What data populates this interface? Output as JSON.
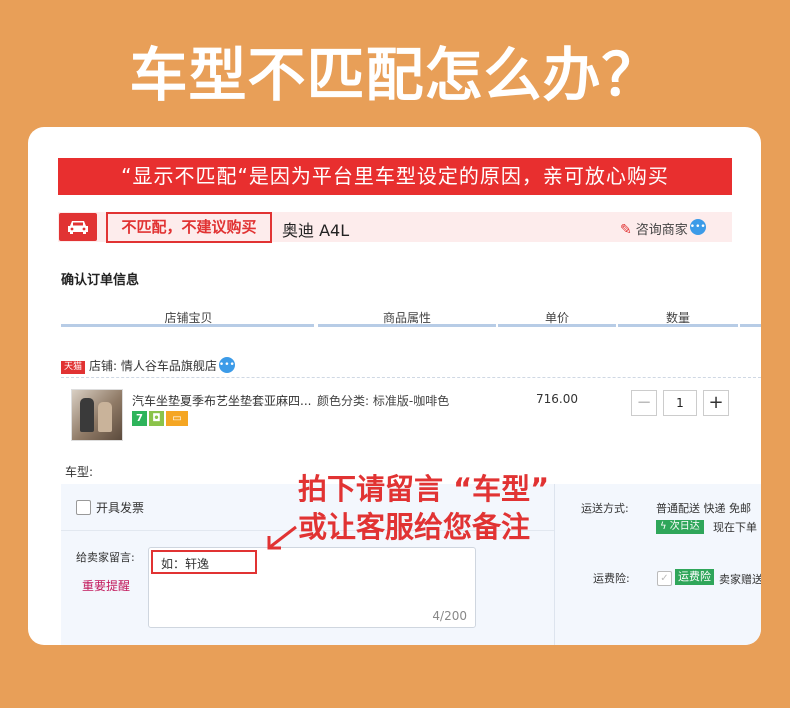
{
  "headline": "车型不匹配怎么办？",
  "banner": "“显示不匹配“是因为平台里车型设定的原因，亲可放心购买",
  "mismatch_bar": {
    "warning": "不匹配，不建议购买",
    "car_model": "奥迪 A4L",
    "consult": "咨询商家"
  },
  "order": {
    "title": "确认订单信息",
    "columns": [
      "店铺宝贝",
      "商品属性",
      "单价",
      "数量"
    ],
    "shop_label": "店铺: 情人谷车品旗舰店",
    "tmall_badge": "天猫",
    "product": {
      "title": "汽车坐垫夏季布艺坐垫套亚麻四...",
      "attribute": "颜色分类: 标准版-咖啡色",
      "price": "716.00",
      "quantity": "1",
      "badge_7": "7"
    }
  },
  "model_label": "车型:",
  "invoice_label": "开具发票",
  "message": {
    "label": "给卖家留言:",
    "reminder": "重要提醒",
    "placeholder": "如：轩逸",
    "count": "4/200"
  },
  "callout": {
    "line1": "拍下请留言 “车型”",
    "line2": "或让客服给您备注"
  },
  "shipping": {
    "label": "运送方式:",
    "value": "普通配送 快递 免邮",
    "fast_badge": "次日达",
    "fast_text": "现在下单"
  },
  "insurance": {
    "label": "运费险:",
    "badge": "运费险",
    "text": "卖家赠送"
  },
  "colors": {
    "background": "#E89F58",
    "accent_red": "#E13333",
    "banner_red": "#E82F2F",
    "green": "#2FA65A"
  }
}
